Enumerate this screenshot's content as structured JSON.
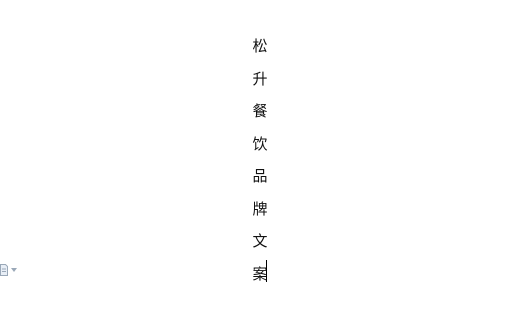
{
  "document": {
    "vertical_text": [
      "松",
      "升",
      "餐",
      "饮",
      "品",
      "牌",
      "文",
      "案"
    ]
  },
  "paste_options": {
    "icon": "document-icon",
    "dropdown_icon": "chevron-down-icon"
  }
}
